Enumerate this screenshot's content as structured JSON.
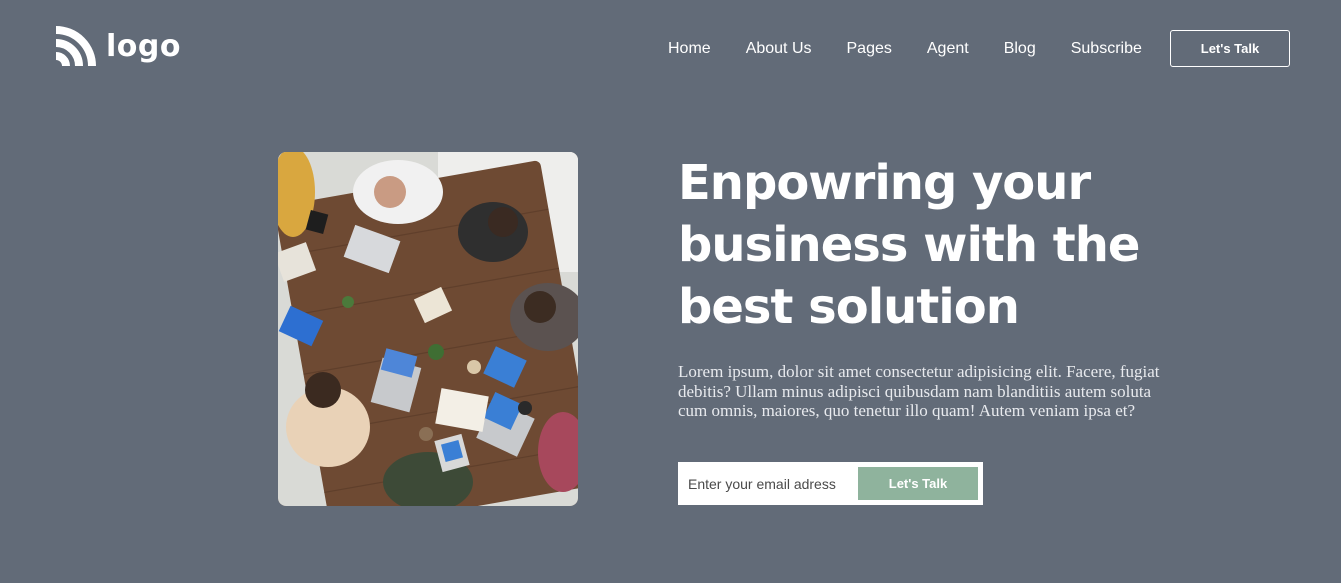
{
  "brand": {
    "logo_text": "logo",
    "logo_icon": "rss-feed-icon"
  },
  "nav": {
    "items": [
      {
        "label": "Home"
      },
      {
        "label": "About Us"
      },
      {
        "label": "Pages"
      },
      {
        "label": "Agent"
      },
      {
        "label": "Blog"
      },
      {
        "label": "Subscribe"
      }
    ],
    "cta_label": "Let's Talk"
  },
  "hero": {
    "headline": "Enpowring your business with the best solution",
    "description": "Lorem ipsum, dolor sit amet consectetur adipisicing elit. Facere, fugiat debitis? Ullam minus adipisci quibusdam nam blanditiis autem soluta cum omnis, maiores, quo tenetur illo quam! Autem veniam ipsa et?",
    "email_value": "",
    "email_placeholder": "Enter your email adress",
    "submit_label": "Let's Talk"
  },
  "colors": {
    "background": "#626b78",
    "accent_button": "#8fb39d",
    "text": "#ffffff"
  }
}
